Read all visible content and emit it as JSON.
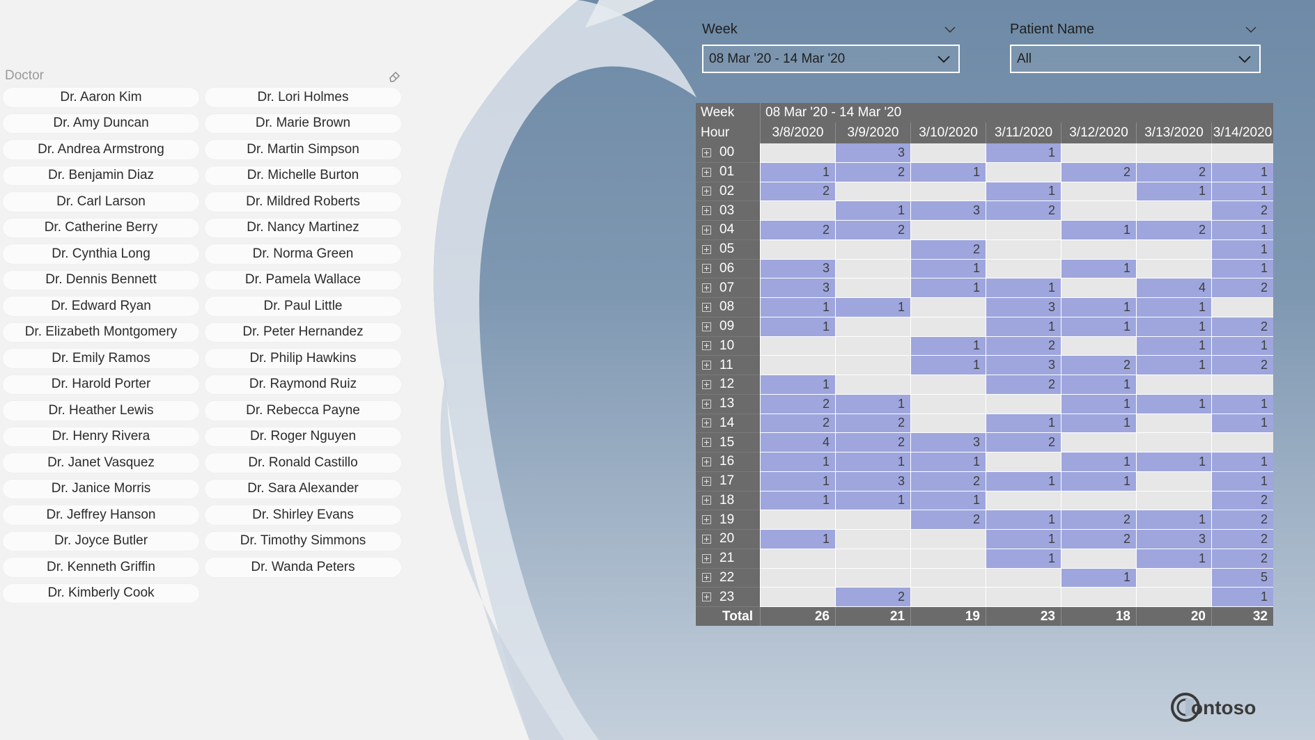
{
  "doctor_slicer": {
    "title": "Doctor",
    "doctors": [
      "Dr. Aaron Kim",
      "Dr. Lori Holmes",
      "Dr. Amy Duncan",
      "Dr. Marie Brown",
      "Dr. Andrea Armstrong",
      "Dr. Martin Simpson",
      "Dr. Benjamin Diaz",
      "Dr. Michelle Burton",
      "Dr. Carl Larson",
      "Dr. Mildred Roberts",
      "Dr. Catherine Berry",
      "Dr. Nancy Martinez",
      "Dr. Cynthia Long",
      "Dr. Norma Green",
      "Dr. Dennis Bennett",
      "Dr. Pamela Wallace",
      "Dr. Edward Ryan",
      "Dr. Paul Little",
      "Dr. Elizabeth Montgomery",
      "Dr. Peter Hernandez",
      "Dr. Emily Ramos",
      "Dr. Philip Hawkins",
      "Dr. Harold Porter",
      "Dr. Raymond Ruiz",
      "Dr. Heather Lewis",
      "Dr. Rebecca Payne",
      "Dr. Henry Rivera",
      "Dr. Roger Nguyen",
      "Dr. Janet Vasquez",
      "Dr. Ronald Castillo",
      "Dr. Janice Morris",
      "Dr. Sara Alexander",
      "Dr. Jeffrey Hanson",
      "Dr. Shirley Evans",
      "Dr. Joyce Butler",
      "Dr. Timothy Simmons",
      "Dr. Kenneth Griffin",
      "Dr. Wanda Peters",
      "Dr. Kimberly Cook"
    ]
  },
  "week_slicer": {
    "label": "Week",
    "value": "08 Mar '20 - 14 Mar '20"
  },
  "patient_slicer": {
    "label": "Patient Name",
    "value": "All"
  },
  "matrix": {
    "week_header": "Week",
    "week_value": "08 Mar '20 - 14 Mar '20",
    "hour_header": "Hour",
    "dates": [
      "3/8/2020",
      "3/9/2020",
      "3/10/2020",
      "3/11/2020",
      "3/12/2020",
      "3/13/2020",
      "3/14/2020"
    ],
    "rows": [
      {
        "hour": "00",
        "values": [
          "",
          "3",
          "",
          "1",
          "",
          "",
          ""
        ]
      },
      {
        "hour": "01",
        "values": [
          "1",
          "2",
          "1",
          "",
          "2",
          "2",
          "1"
        ]
      },
      {
        "hour": "02",
        "values": [
          "2",
          "",
          "",
          "1",
          "",
          "1",
          "1"
        ]
      },
      {
        "hour": "03",
        "values": [
          "",
          "1",
          "3",
          "2",
          "",
          "",
          "2"
        ]
      },
      {
        "hour": "04",
        "values": [
          "2",
          "2",
          "",
          "",
          "1",
          "2",
          "1"
        ]
      },
      {
        "hour": "05",
        "values": [
          "",
          "",
          "2",
          "",
          "",
          "",
          "1"
        ]
      },
      {
        "hour": "06",
        "values": [
          "3",
          "",
          "1",
          "",
          "1",
          "",
          "1"
        ]
      },
      {
        "hour": "07",
        "values": [
          "3",
          "",
          "1",
          "1",
          "",
          "4",
          "2"
        ]
      },
      {
        "hour": "08",
        "values": [
          "1",
          "1",
          "",
          "3",
          "1",
          "1",
          ""
        ]
      },
      {
        "hour": "09",
        "values": [
          "1",
          "",
          "",
          "1",
          "1",
          "1",
          "2"
        ]
      },
      {
        "hour": "10",
        "values": [
          "",
          "",
          "1",
          "2",
          "",
          "1",
          "1"
        ]
      },
      {
        "hour": "11",
        "values": [
          "",
          "",
          "1",
          "3",
          "2",
          "1",
          "2"
        ]
      },
      {
        "hour": "12",
        "values": [
          "1",
          "",
          "",
          "2",
          "1",
          "",
          ""
        ]
      },
      {
        "hour": "13",
        "values": [
          "2",
          "1",
          "",
          "",
          "1",
          "1",
          "1"
        ]
      },
      {
        "hour": "14",
        "values": [
          "2",
          "2",
          "",
          "1",
          "1",
          "",
          "1"
        ]
      },
      {
        "hour": "15",
        "values": [
          "4",
          "2",
          "3",
          "2",
          "",
          "",
          ""
        ]
      },
      {
        "hour": "16",
        "values": [
          "1",
          "1",
          "1",
          "",
          "1",
          "1",
          "1"
        ]
      },
      {
        "hour": "17",
        "values": [
          "1",
          "3",
          "2",
          "1",
          "1",
          "",
          "1"
        ]
      },
      {
        "hour": "18",
        "values": [
          "1",
          "1",
          "1",
          "",
          "",
          "",
          "2"
        ]
      },
      {
        "hour": "19",
        "values": [
          "",
          "",
          "2",
          "1",
          "2",
          "1",
          "2"
        ]
      },
      {
        "hour": "20",
        "values": [
          "1",
          "",
          "",
          "1",
          "2",
          "3",
          "2"
        ]
      },
      {
        "hour": "21",
        "values": [
          "",
          "",
          "",
          "1",
          "",
          "1",
          "2"
        ]
      },
      {
        "hour": "22",
        "values": [
          "",
          "",
          "",
          "",
          "1",
          "",
          "5"
        ]
      },
      {
        "hour": "23",
        "values": [
          "",
          "2",
          "",
          "",
          "",
          "",
          "1"
        ]
      }
    ],
    "total_label": "Total",
    "totals": [
      "26",
      "21",
      "19",
      "23",
      "18",
      "20",
      "32"
    ]
  },
  "logo": {
    "text": "ontoso"
  },
  "colors": {
    "filled_cell": "#9ea6dd",
    "empty_cell": "#e7e7e7",
    "header": "#6b6b6b"
  }
}
